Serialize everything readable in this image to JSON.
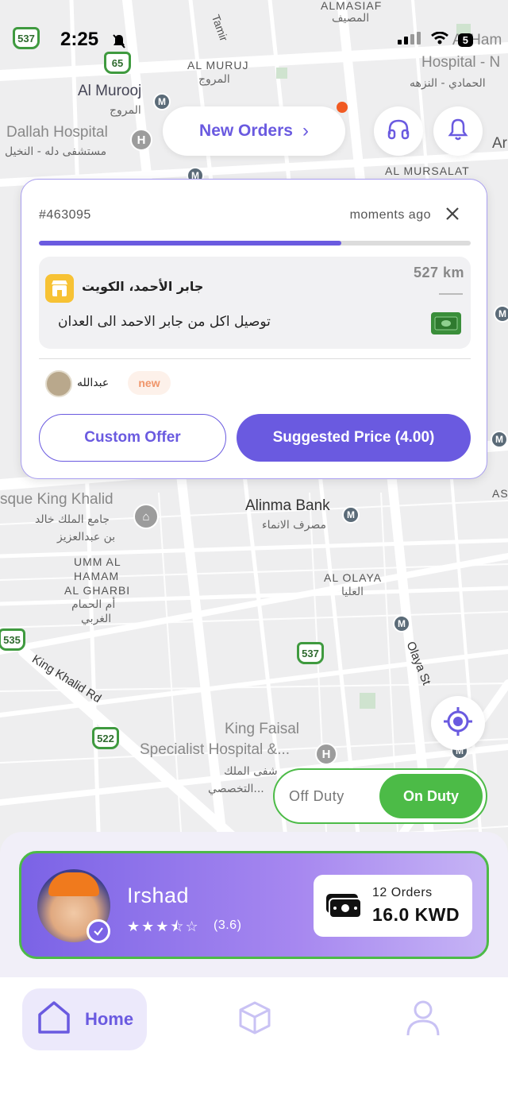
{
  "status_bar": {
    "time": "2:25",
    "battery": "5"
  },
  "map": {
    "labels": {
      "al_masiaf": "ALMASIAF",
      "al_masiaf_ar": "المصيف",
      "tamir": "Tamir",
      "al_muruj": "AL MURUJ",
      "al_muruj_ar": "المروج",
      "al_murooj": "Al Murooj",
      "al_murooj_ar": "المروج",
      "dallah": "Dallah Hospital",
      "dallah_ar": "مستشفى دله - النخيل",
      "al_hammadi": "Al Ham",
      "al_hammadi2": "Hospital - N",
      "al_hammadi_ar": "الحمادي - النزهه",
      "al_mursalat": "AL MURSALAT",
      "ar_edge": "Ar",
      "mosque": "sque King Khalid",
      "mosque_ar1": "جامع الملك خالد",
      "mosque_ar2": "بن عبدالعزيز",
      "alinma": "Alinma Bank",
      "alinma_ar": "مصرف الانماء",
      "umm_1": "UMM AL",
      "umm_2": "HAMAM",
      "umm_3": "AL GHARBI",
      "umm_ar1": "أم الحمام",
      "umm_ar2": "الغربي",
      "al_olaya": "AL OLAYA",
      "al_olaya_ar": "العليا",
      "olaya_st": "Olaya St",
      "king_khalid_rd": "King Khalid Rd",
      "king_faisal": "King Faisal",
      "king_faisal_2": "Specialist Hospital &...",
      "king_faisal_ar1": "شفى الملك",
      "king_faisal_ar2": "...التخصصي",
      "as_edge": "AS"
    },
    "shields": {
      "s537a": "537",
      "s65": "65",
      "s535": "535",
      "s537b": "537",
      "s522": "522"
    }
  },
  "header": {
    "new_orders_label": "New Orders",
    "new_orders_chevron": "›"
  },
  "order": {
    "id": "#463095",
    "time": "moments ago",
    "progress": 0.7,
    "store_name": "جابر الأحمد، الكويت",
    "distance": "527 km",
    "description": "توصيل اكل من جابر الاحمد الى العدان",
    "customer_name": "عبدالله",
    "customer_badge": "new",
    "custom_offer_label": "Custom Offer",
    "suggested_price_label": "Suggested Price (4.00)"
  },
  "duty": {
    "off_label": "Off Duty",
    "on_label": "On Duty",
    "state": "on"
  },
  "driver": {
    "name": "Irshad",
    "stars": "★★★⯪☆",
    "rating": "(3.6)",
    "orders_count": "12 Orders",
    "earnings": "16.0 KWD"
  },
  "tabs": {
    "home_label": "Home"
  },
  "colors": {
    "accent": "#6a5ae0",
    "success": "#4cbb47",
    "alert": "#f15a22"
  }
}
